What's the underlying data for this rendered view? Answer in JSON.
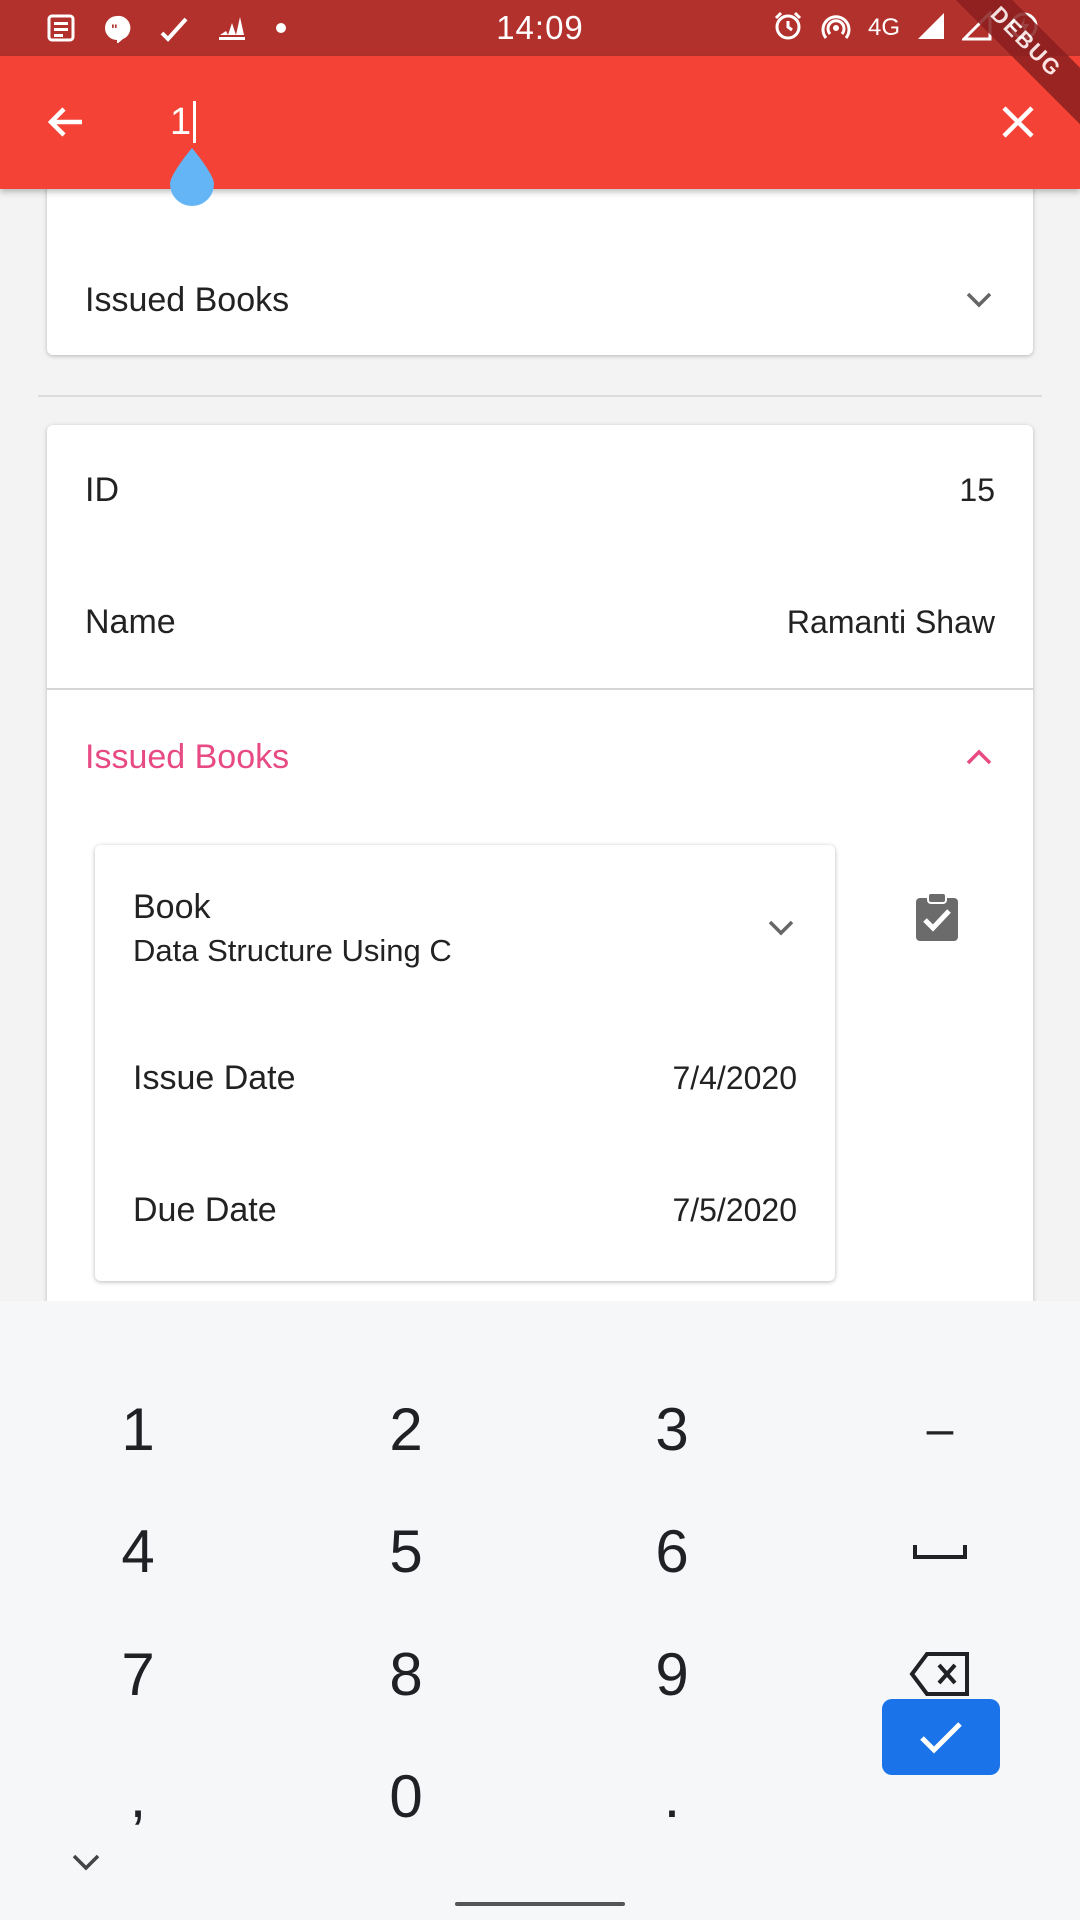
{
  "status_bar": {
    "time": "14:09",
    "network": "4G",
    "left_icons": [
      "news-icon",
      "chat-quote-icon",
      "check-icon",
      "adidas-icon",
      "dot-icon"
    ],
    "right_icons": [
      "alarm-icon",
      "hotspot-icon",
      "signal-icon",
      "signal-icon",
      "battery-saver-icon"
    ]
  },
  "debug_banner": "DEBUG",
  "app_bar": {
    "search_value": "1",
    "back_icon": "arrow-back-icon",
    "close_icon": "close-icon",
    "color": "#f44336"
  },
  "card1": {
    "section_label": "Issued Books"
  },
  "card2": {
    "id_label": "ID",
    "id_value": "15",
    "name_label": "Name",
    "name_value": "Ramanti Shaw",
    "section_label": "Issued Books",
    "accent_color": "#e84a83",
    "book": {
      "label": "Book",
      "title": "Data Structure Using C",
      "issue_date_label": "Issue Date",
      "issue_date": "7/4/2020",
      "due_date_label": "Due Date",
      "due_date": "7/5/2020"
    }
  },
  "keyboard": {
    "keys": [
      "1",
      "2",
      "3",
      "–",
      "4",
      "5",
      "6",
      "␣",
      "7",
      "8",
      "9",
      "⌫",
      ",",
      "0",
      ".",
      "✓"
    ]
  }
}
